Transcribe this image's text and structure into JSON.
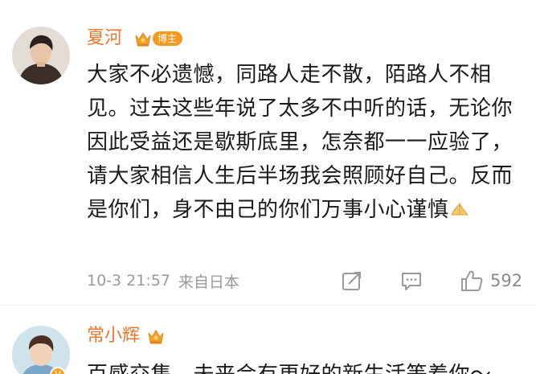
{
  "comments": [
    {
      "username": "夏河",
      "badge_label": "博主",
      "text": "大家不必遗憾，同路人走不散，陌路人不相见。过去这些年说了太多不中听的话，无论你因此受益还是歇斯底里，怎奈都一一应验了，请大家相信人生后半场我会照顾好自己。反而是你们，身不由己的你们万事小心谨慎",
      "emoji": "folded-hands-emoji",
      "timestamp": "10-3 21:57",
      "source": "来自日本",
      "like_count": "592"
    },
    {
      "username": "常小辉",
      "text": "百感交集，未来会有更好的新生活等着你～"
    }
  ],
  "colors": {
    "username": "#e8762b",
    "badge": "#f39a1e",
    "meta": "#9a9a9a"
  }
}
